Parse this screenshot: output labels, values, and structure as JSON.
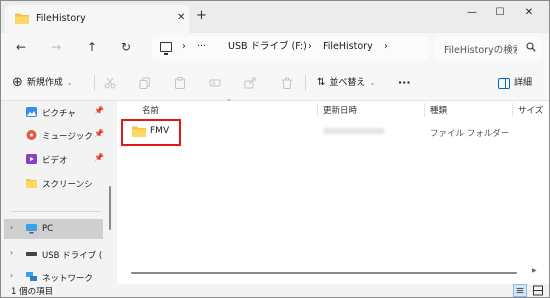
{
  "tab": {
    "title": "FileHistory",
    "close": "✕",
    "new_tab": "+"
  },
  "window_controls": {
    "minimize": "—",
    "maximize": "☐",
    "close": "✕"
  },
  "nav": {
    "back": "←",
    "forward": "→",
    "up": "↑",
    "refresh": "↻"
  },
  "address": {
    "ellipsis": "···",
    "segments": [
      "USB ドライブ (F:)",
      "FileHistory"
    ],
    "separator": "›"
  },
  "search": {
    "placeholder": "FileHistoryの検索"
  },
  "toolbar": {
    "new_label": "新規作成",
    "sort_label": "並べ替え",
    "more_label": "···",
    "details_label": "詳細",
    "icons": [
      "cut-icon",
      "copy-icon",
      "paste-icon",
      "rename-icon",
      "share-icon",
      "delete-icon"
    ]
  },
  "sidebar": {
    "items": [
      {
        "label": "ピクチャ",
        "icon": "pictures-icon",
        "pinned": true
      },
      {
        "label": "ミュージック",
        "icon": "music-icon",
        "pinned": true
      },
      {
        "label": "ビデオ",
        "icon": "videos-icon",
        "pinned": true
      },
      {
        "label": "スクリーンショット",
        "icon": "folder-icon",
        "pinned": false
      },
      {
        "label": "PC",
        "icon": "pc-icon",
        "selected": true
      },
      {
        "label": "USB ドライブ (F:)",
        "icon": "usb-drive-icon"
      },
      {
        "label": "ネットワーク",
        "icon": "network-icon"
      }
    ]
  },
  "columns": {
    "name": "名前",
    "date": "更新日時",
    "type": "種類",
    "size": "サイズ"
  },
  "files": [
    {
      "name": "FMV",
      "type": "ファイル フォルダー"
    }
  ],
  "status": {
    "count": "1 個の項目"
  },
  "colors": {
    "highlight": "#e0191a",
    "folder": "#f5c542",
    "accent": "#0067c0"
  }
}
